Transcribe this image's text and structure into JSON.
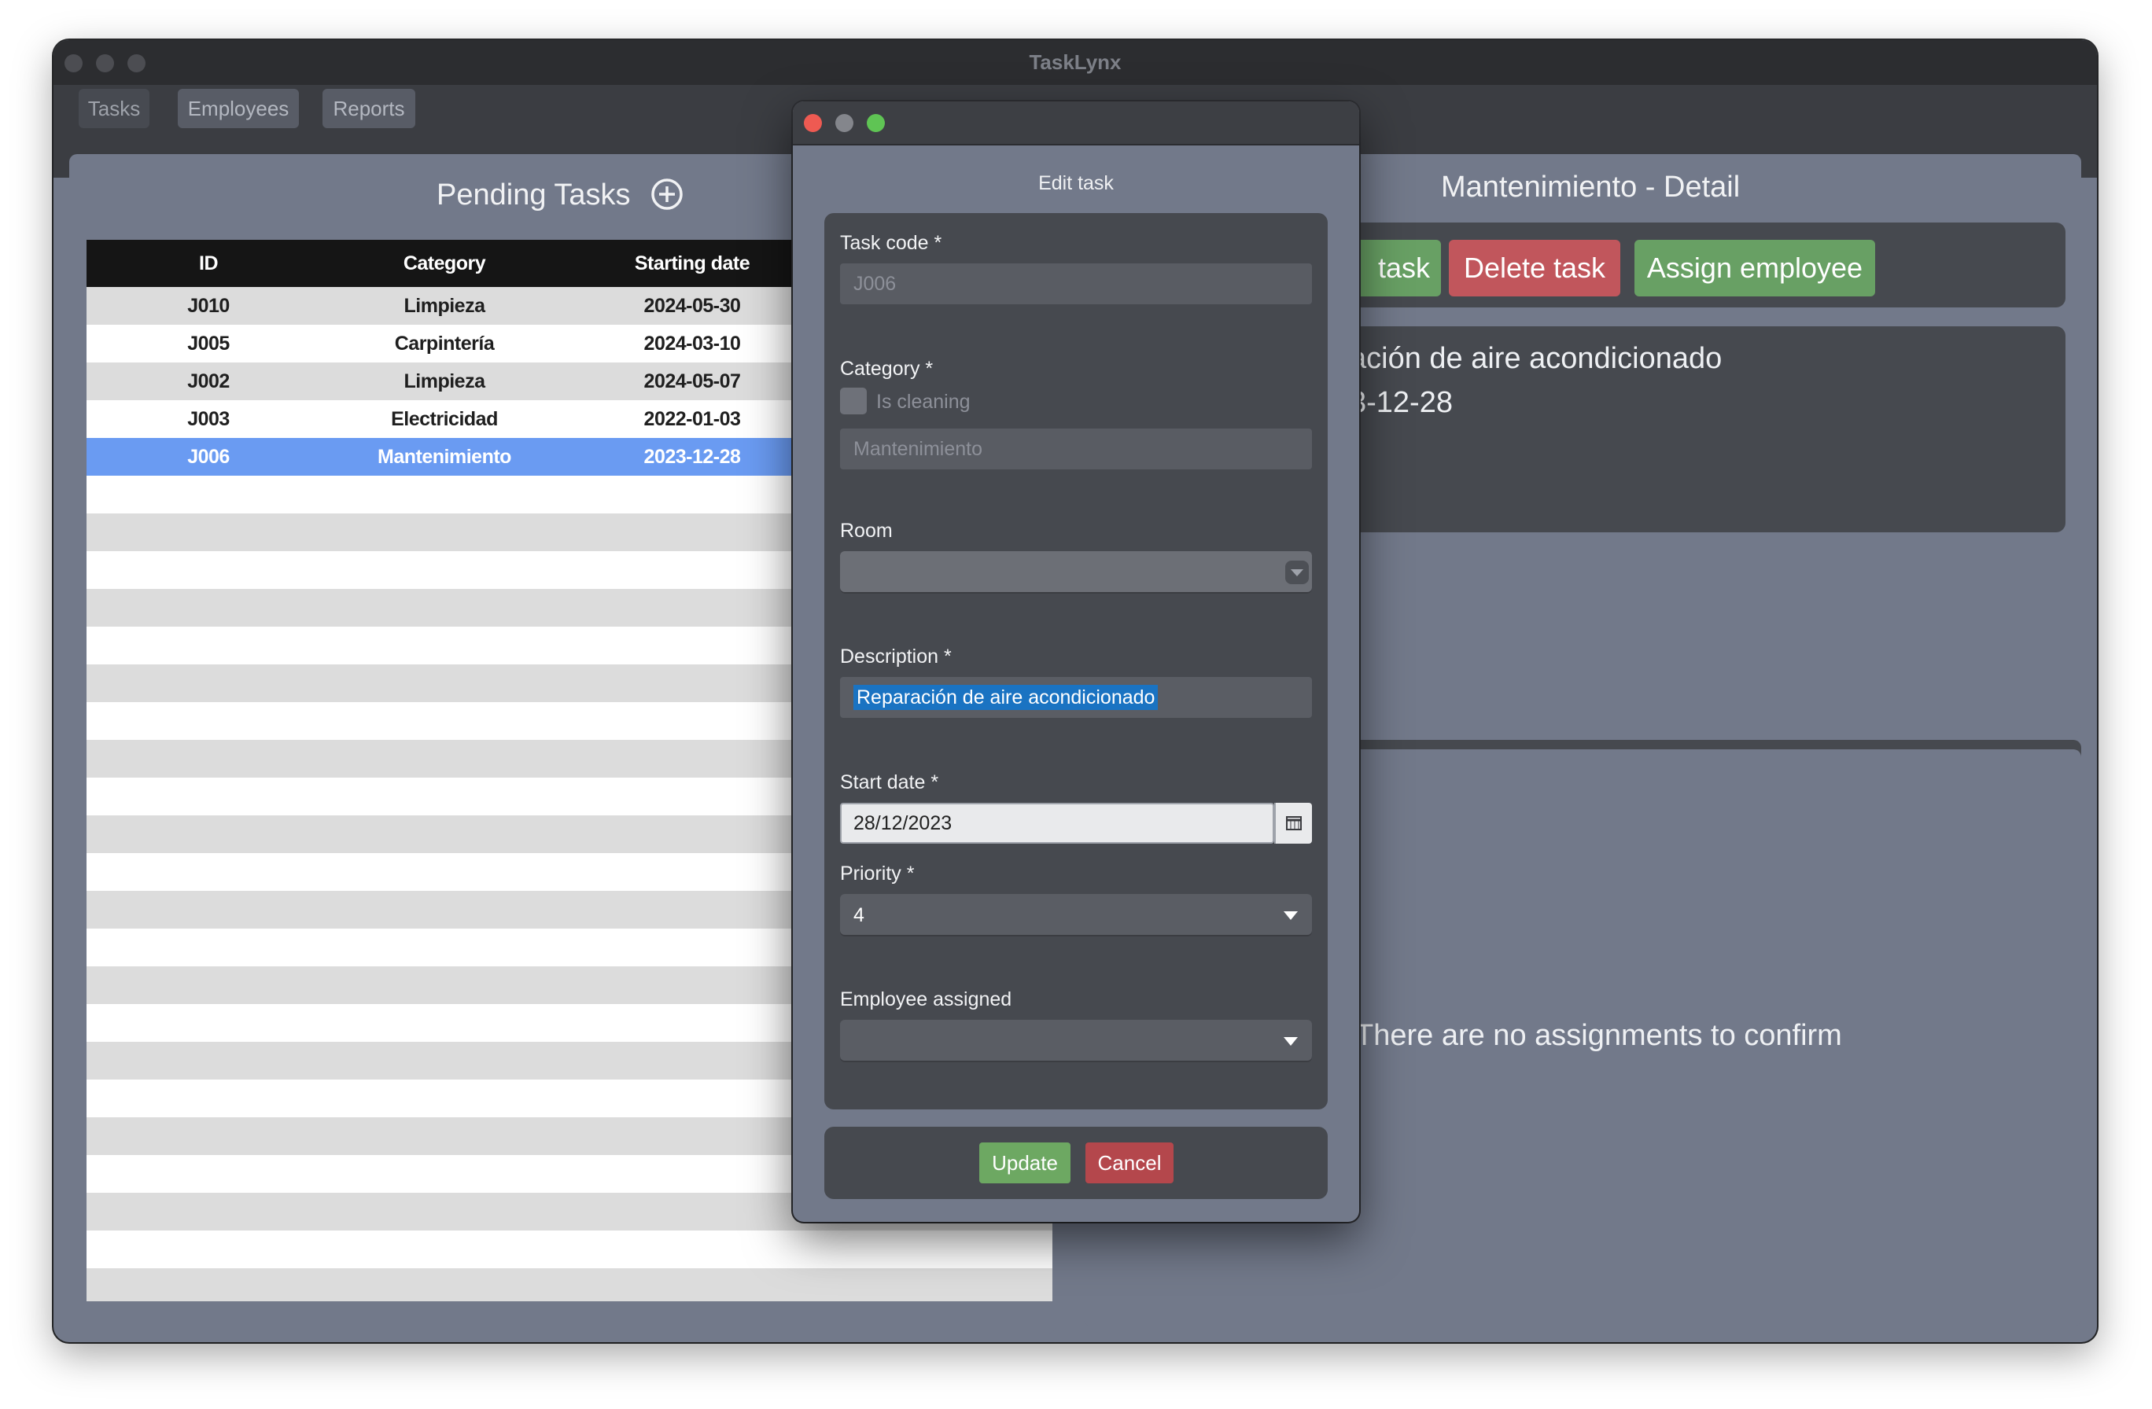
{
  "app": {
    "title": "TaskLynx"
  },
  "menu": {
    "items": [
      "Tasks",
      "Employees",
      "Reports"
    ]
  },
  "pending": {
    "title": "Pending Tasks",
    "columns": [
      "ID",
      "Category",
      "Starting date"
    ],
    "rows": [
      {
        "id": "J010",
        "category": "Limpieza",
        "date": "2024-05-30"
      },
      {
        "id": "J005",
        "category": "Carpintería",
        "date": "2024-03-10"
      },
      {
        "id": "J002",
        "category": "Limpieza",
        "date": "2024-05-07"
      },
      {
        "id": "J003",
        "category": "Electricidad",
        "date": "2022-01-03"
      },
      {
        "id": "J006",
        "category": "Mantenimiento",
        "date": "2023-12-28"
      }
    ],
    "selected_row": 4
  },
  "detail": {
    "title": "Mantenimiento - Detail",
    "edit_label_visible": "task",
    "delete_label": "Delete task",
    "assign_label": "Assign employee",
    "line1_visible": "ación de aire acondicionado",
    "line2_visible": "3-12-28",
    "no_assignments": "There are no assignments to confirm"
  },
  "dialog": {
    "title": "Edit task",
    "task_code": {
      "label": "Task code *",
      "value": "J006"
    },
    "category": {
      "label": "Category *",
      "checkbox_label": "Is cleaning",
      "value": "Mantenimiento"
    },
    "room": {
      "label": "Room",
      "value": ""
    },
    "description": {
      "label": "Description *",
      "value": "Reparación de aire acondicionado"
    },
    "start_date": {
      "label": "Start date *",
      "value": "28/12/2023"
    },
    "priority": {
      "label": "Priority *",
      "value": "4"
    },
    "employee": {
      "label": "Employee assigned",
      "value": ""
    },
    "update_label": "Update",
    "cancel_label": "Cancel"
  },
  "colors": {
    "delete": "#c1565c",
    "assign": "#68a064",
    "update": "#6da862",
    "cancel": "#b4474c",
    "selection": "#6a9bf2"
  }
}
